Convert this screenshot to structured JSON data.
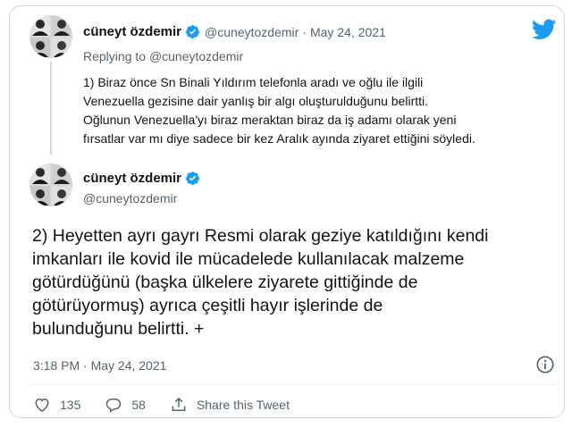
{
  "reply_tweet": {
    "author_name": "cüneyt özdemir",
    "handle": "@cuneytozdemir",
    "separator": "·",
    "date": "May 24, 2021",
    "replying_prefix": "Replying to",
    "replying_to": "@cuneytozdemir",
    "text_lines": [
      "1) Biraz önce Sn Binali Yıldırım telefonla aradı ve oğlu ile ilgili",
      "Venezuella gezisine dair yanlış bir algı oluşturulduğunu belirtti.",
      "Oğlunun Venezuella'yı biraz meraktan biraz da iş adamı olarak yeni",
      "fırsatlar var mı diye sadece bir kez Aralık ayında ziyaret ettiğini söyledi."
    ]
  },
  "main_tweet": {
    "author_name": "cüneyt özdemir",
    "handle": "@cuneytozdemir",
    "text_lines": [
      "2) Heyetten ayrı gayrı Resmi olarak geziye katıldığını kendi",
      "imkanları ile kovid ile mücadelede kullanılacak malzeme",
      "götürdüğünü (başka ülkelere ziyarete gittiğinde de",
      "götürüyormuş)  ayrıca çeşitli hayır işlerinde de",
      "bulunduğunu belirtti. +"
    ],
    "timestamp": "3:18 PM · May 24, 2021"
  },
  "actions": {
    "likes": "135",
    "replies": "58",
    "share_label": "Share this Tweet"
  },
  "colors": {
    "twitter_blue": "#1d9bf0",
    "secondary_text": "#536471",
    "border": "#cfd9de"
  },
  "icons": [
    "twitter-bird-icon",
    "verified-badge-icon",
    "info-icon",
    "heart-icon",
    "reply-icon",
    "share-icon"
  ]
}
